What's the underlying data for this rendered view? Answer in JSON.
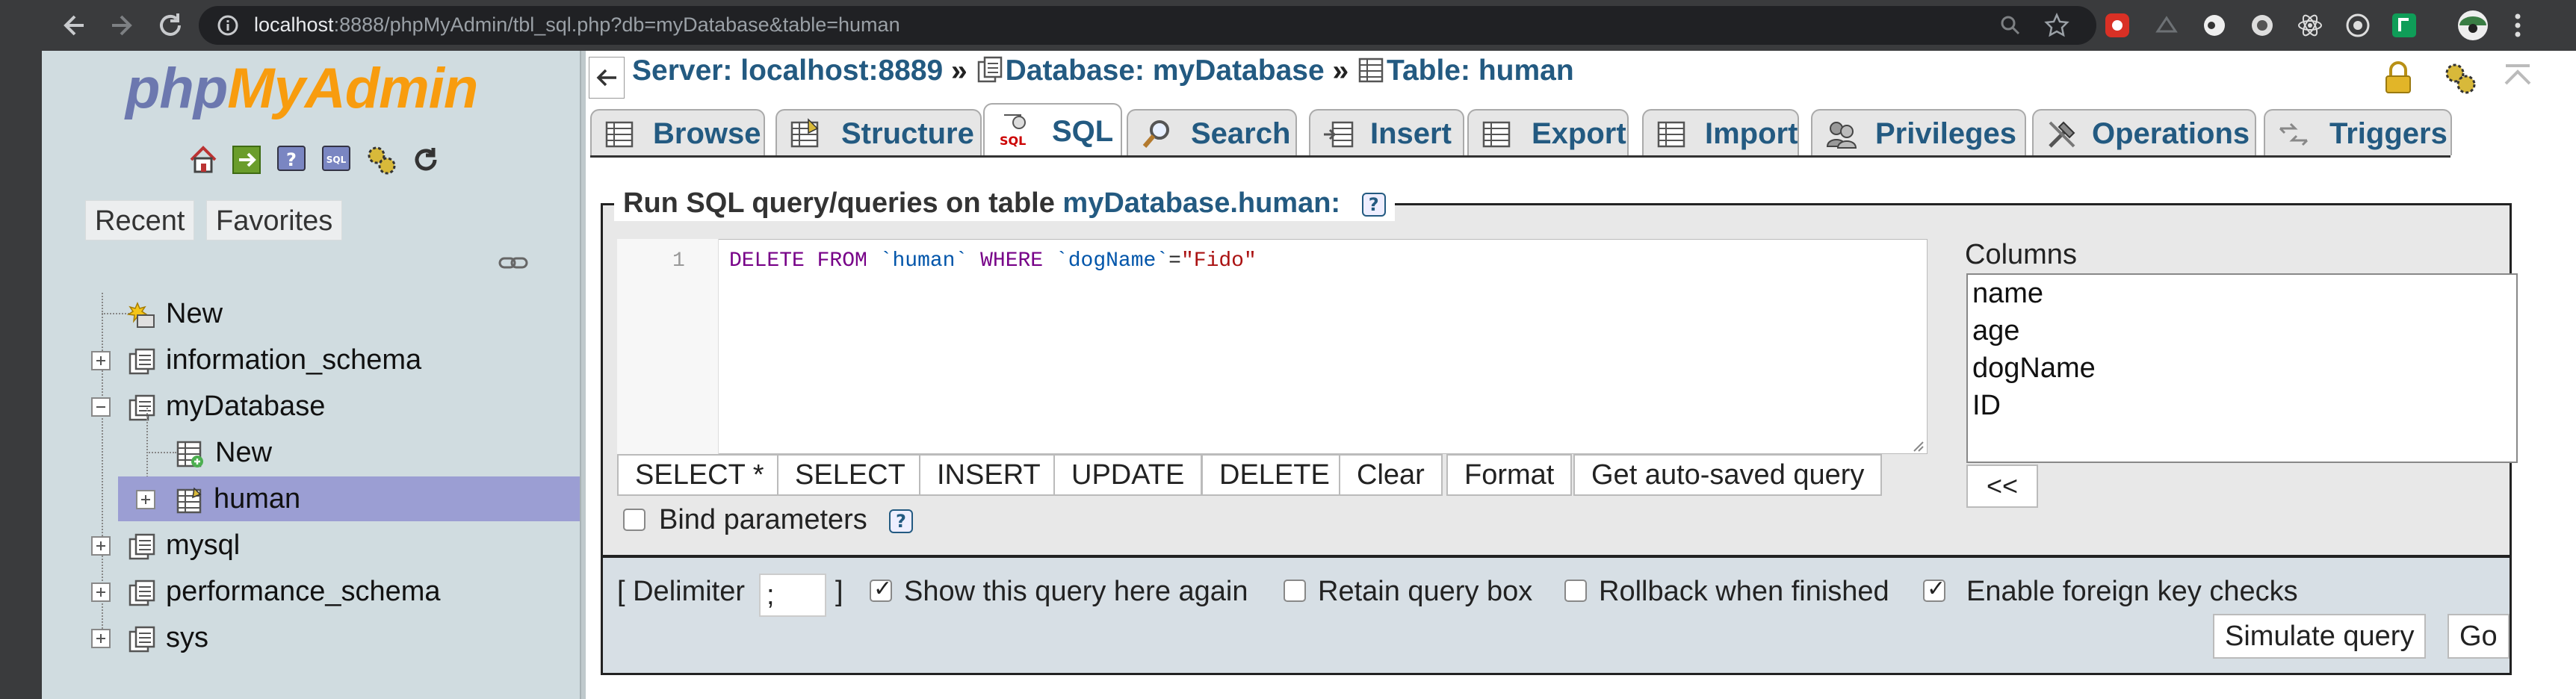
{
  "browser": {
    "url_host": "localhost",
    "url_rest": ":8888/phpMyAdmin/tbl_sql.php?db=myDatabase&table=human"
  },
  "nav": {
    "logo_php": "php",
    "logo_my": "MyAdmin",
    "tabs": [
      "Recent",
      "Favorites"
    ],
    "tree": [
      {
        "label": "New",
        "kind": "new-db"
      },
      {
        "label": "information_schema",
        "kind": "db"
      },
      {
        "label": "myDatabase",
        "kind": "db",
        "expanded": true
      },
      {
        "label": "New",
        "kind": "new-table"
      },
      {
        "label": "human",
        "kind": "table",
        "selected": true
      },
      {
        "label": "mysql",
        "kind": "db"
      },
      {
        "label": "performance_schema",
        "kind": "db"
      },
      {
        "label": "sys",
        "kind": "db"
      }
    ]
  },
  "breadcrumb": {
    "server": "Server: localhost:8889",
    "database": "Database: myDatabase",
    "table": "Table: human",
    "separator": "»"
  },
  "tabs": [
    {
      "label": "Browse"
    },
    {
      "label": "Structure"
    },
    {
      "label": "SQL",
      "active": true
    },
    {
      "label": "Search"
    },
    {
      "label": "Insert"
    },
    {
      "label": "Export"
    },
    {
      "label": "Import"
    },
    {
      "label": "Privileges"
    },
    {
      "label": "Operations"
    },
    {
      "label": "Triggers"
    }
  ],
  "sql": {
    "legend_prefix": "Run SQL query/queries on table",
    "legend_db": "myDatabase.human:",
    "line_number": "1",
    "code": {
      "kw1": "DELETE FROM",
      "table": "`human`",
      "kw2": "WHERE",
      "col": "`dogName`",
      "op": "=",
      "value": "\"Fido\""
    },
    "buttons": [
      "SELECT *",
      "SELECT",
      "INSERT",
      "UPDATE",
      "DELETE",
      "Clear",
      "Format",
      "Get auto-saved query"
    ],
    "bind_params": "Bind parameters",
    "help": "?",
    "columns_label": "Columns",
    "columns": [
      "name",
      "age",
      "dogName",
      "ID"
    ],
    "insert_column_btn": "<<"
  },
  "footer": {
    "delimiter_open": "[ Delimiter",
    "delimiter_value": ";",
    "delimiter_close": "]",
    "show_query": "Show this query here again",
    "retain_box": "Retain query box",
    "rollback": "Rollback when finished",
    "foreign_keys": "Enable foreign key checks",
    "simulate": "Simulate query",
    "go": "Go"
  }
}
